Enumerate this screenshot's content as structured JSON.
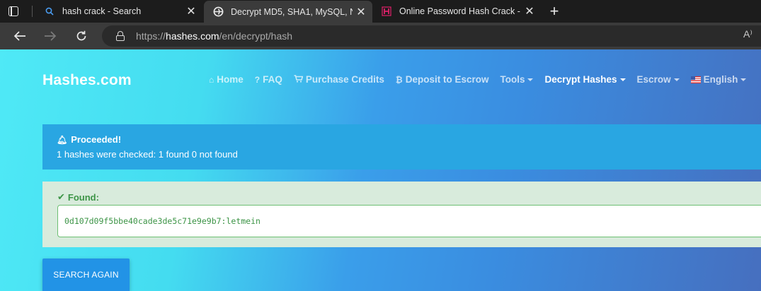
{
  "browser": {
    "tabs": [
      {
        "title": "hash crack - Search",
        "icon": "search-icon",
        "active": false
      },
      {
        "title": "Decrypt MD5, SHA1, MySQL, NTI",
        "icon": "globe-icon",
        "active": true
      },
      {
        "title": "Online Password Hash Crack - M",
        "icon": "onlinehashcrack-icon",
        "active": false
      }
    ],
    "new_tab_label": "+",
    "url_scheme": "https://",
    "url_host": "hashes.com",
    "url_path": "/en/decrypt/hash",
    "read_aloud_label": "A⁾"
  },
  "site": {
    "brand": "Hashes.com",
    "nav": [
      {
        "label": "Home",
        "icon": "home-icon",
        "dropdown": false,
        "active": false
      },
      {
        "label": "FAQ",
        "icon": "question-icon",
        "dropdown": false,
        "active": false
      },
      {
        "label": "Purchase Credits",
        "icon": "cart-icon",
        "dropdown": false,
        "active": false
      },
      {
        "label": "Deposit to Escrow",
        "icon": "bitcoin-icon",
        "dropdown": false,
        "active": false
      },
      {
        "label": "Tools",
        "icon": "",
        "dropdown": true,
        "active": false
      },
      {
        "label": "Decrypt Hashes",
        "icon": "",
        "dropdown": true,
        "active": true
      },
      {
        "label": "Escrow",
        "icon": "",
        "dropdown": true,
        "active": false
      },
      {
        "label": "English",
        "icon": "us-flag-icon",
        "dropdown": true,
        "active": false
      }
    ]
  },
  "info_alert": {
    "heading": "Proceeded!",
    "message": "1 hashes were checked: 1 found 0 not found"
  },
  "success_alert": {
    "heading": "Found:",
    "result": "0d107d09f5bbe40cade3de5c71e9e9b7:letmein"
  },
  "search_again_label": "SEARCH AGAIN",
  "colors": {
    "info_bg": "#29a6e2",
    "success_bg": "#d8ebdc",
    "success_text": "#3c9446",
    "button_bg": "#2293e6"
  }
}
